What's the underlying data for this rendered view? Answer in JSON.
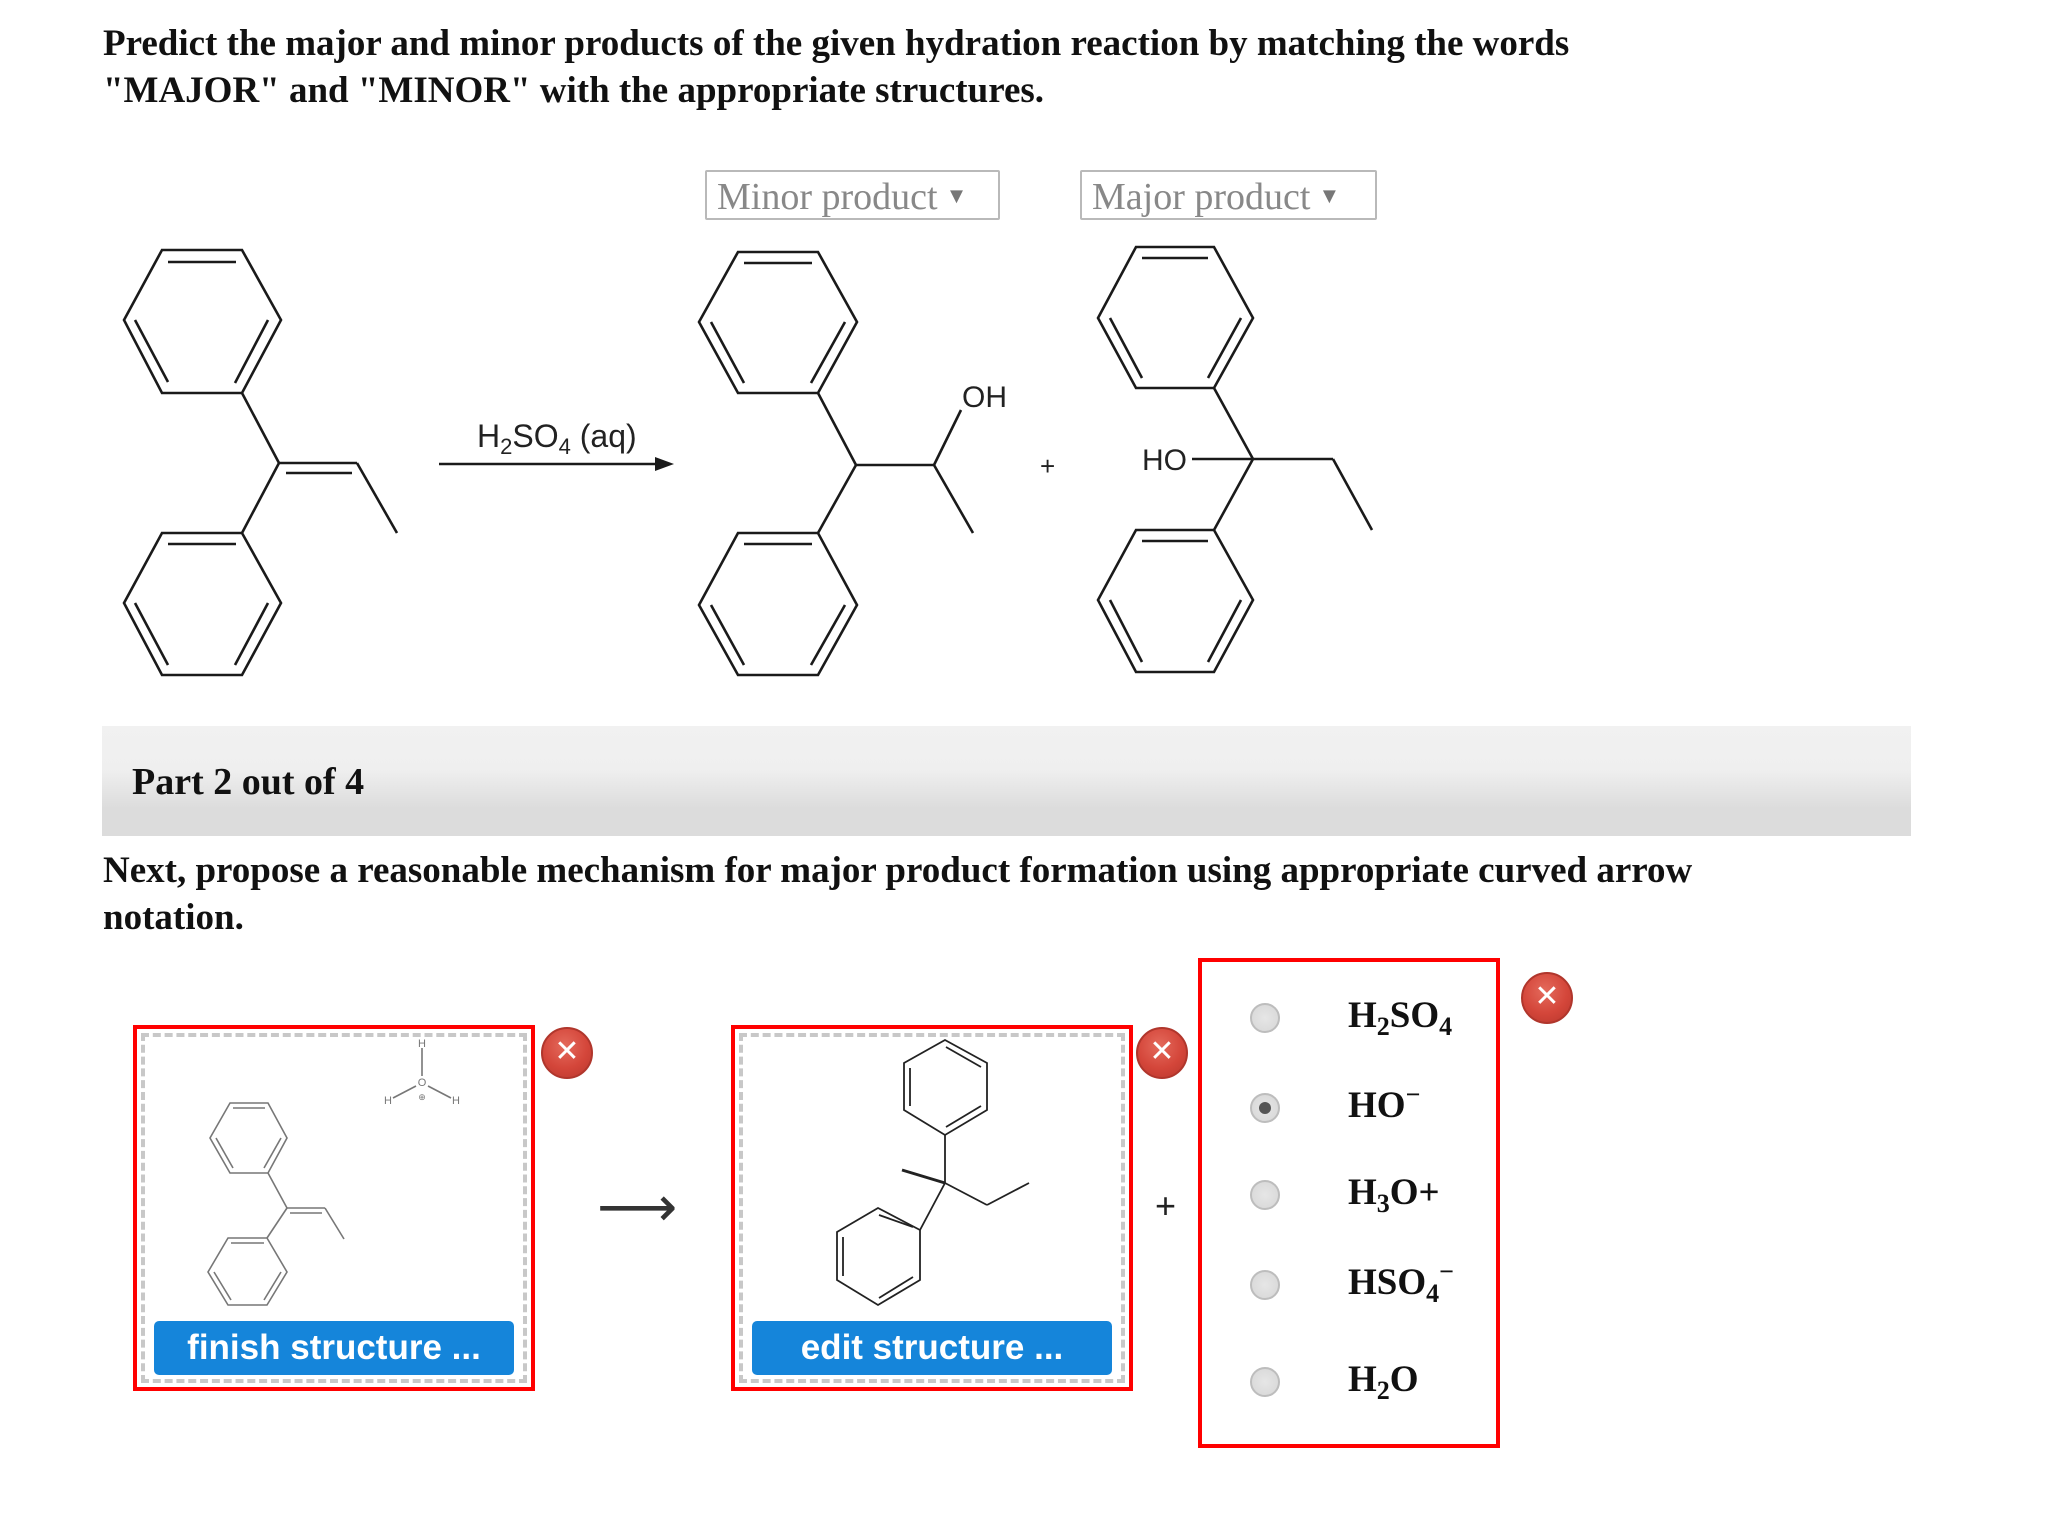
{
  "question": {
    "line1": "Predict the major and minor products of the given hydration reaction by matching the words",
    "line2": "\"MAJOR\" and \"MINOR\" with the appropriate structures."
  },
  "dropdowns": [
    {
      "selected": "Minor product",
      "caret": "▼"
    },
    {
      "selected": "Major product",
      "caret": "▼"
    }
  ],
  "reaction": {
    "reagent_main": "H",
    "reagent_sub1": "2",
    "reagent_mid": "SO",
    "reagent_sub2": "4",
    "reagent_tail": " (aq)",
    "plus": "+",
    "minor_product_label": "OH",
    "major_product_label": "HO"
  },
  "part": {
    "label": "Part 2 out of 4"
  },
  "instruction": {
    "line1": "Next, propose a reasonable mechanism for major product formation using appropriate curved arrow",
    "line2": "notation."
  },
  "mechanism": {
    "box1_button": "finish structure ...",
    "box2_button": "edit structure ...",
    "arrow": "⟶",
    "plus": "+",
    "close_glyph": "✕",
    "hydronium": {
      "O": "O",
      "H": "H",
      "charge": "⊕"
    }
  },
  "options": {
    "selected_index": 1,
    "items": [
      {
        "base": "H",
        "sub": "2",
        "rest": "SO",
        "sub2": "4",
        "sup": ""
      },
      {
        "base": "HO",
        "sub": "",
        "rest": "",
        "sub2": "",
        "sup": "−"
      },
      {
        "base": "H",
        "sub": "3",
        "rest": "O+",
        "sub2": "",
        "sup": ""
      },
      {
        "base": "HSO",
        "sub": "",
        "rest": "",
        "sub2": "4",
        "sup": "−"
      },
      {
        "base": "H",
        "sub": "2",
        "rest": "O",
        "sub2": "",
        "sup": ""
      }
    ]
  },
  "colors": {
    "error_border": "#ff0000",
    "button_blue": "#1585da",
    "close_red": "#d4463a"
  }
}
